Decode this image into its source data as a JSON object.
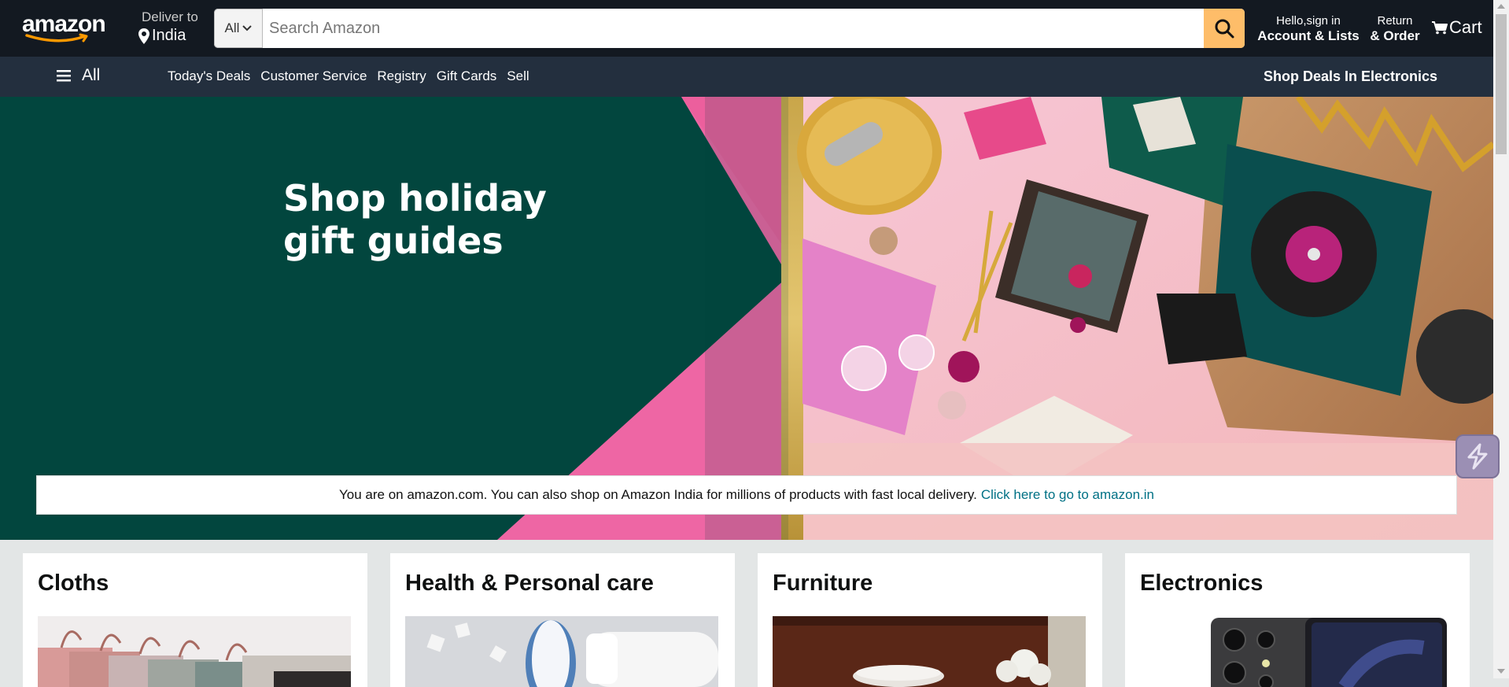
{
  "header": {
    "logo_text": "amazon",
    "deliver_line1": "Deliver to",
    "deliver_line2": "India",
    "search_category": "All",
    "search_placeholder": "Search Amazon",
    "account_line1": "Hello,sign in",
    "account_line2": "Account & Lists",
    "returns_line1": "Return",
    "returns_line2": "& Order",
    "cart_label": "Cart"
  },
  "subnav": {
    "all_label": "All",
    "links": [
      "Today's Deals",
      "Customer Service",
      "Registry",
      "Gift Cards",
      "Sell"
    ],
    "promo": "Shop Deals In Electronics"
  },
  "hero": {
    "title_line1": "Shop holiday",
    "title_line2": "gift guides",
    "notice_text": "You are on amazon.com. You can also shop on Amazon India for millions of products with fast local delivery.",
    "notice_link": "Click here to go to amazon.in"
  },
  "cards": [
    {
      "title": "Cloths"
    },
    {
      "title": "Health & Personal care"
    },
    {
      "title": "Furniture"
    },
    {
      "title": "Electronics"
    }
  ],
  "colors": {
    "nav_bg": "#131921",
    "subnav_bg": "#232f3e",
    "search_btn": "#febd69",
    "hero_green": "#02463e",
    "hero_pink": "#ee66a4",
    "link": "#007185"
  }
}
